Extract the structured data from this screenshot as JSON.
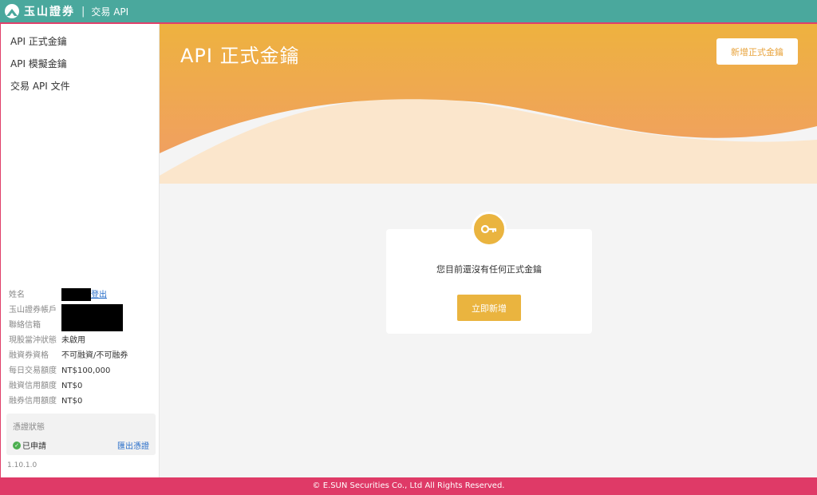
{
  "header": {
    "brand": "玉山證券",
    "separator": "|",
    "product": "交易 API"
  },
  "sidebar": {
    "nav": [
      {
        "label": "API 正式金鑰"
      },
      {
        "label": "API 模擬金鑰"
      },
      {
        "label": "交易 API 文件"
      }
    ],
    "info": {
      "name_label": "姓名",
      "logout": "登出",
      "account_label": "玉山證券帳戶",
      "email_label": "聯絡信箱",
      "daytrade_label": "現股當沖狀態",
      "daytrade_value": "未啟用",
      "margin_label": "融資券資格",
      "margin_value": "不可融資/不可融券",
      "daily_limit_label": "每日交易額度",
      "daily_limit_value": "NT$100,000",
      "margin_credit_label": "融資信用額度",
      "margin_credit_value": "NT$0",
      "short_credit_label": "融券信用額度",
      "short_credit_value": "NT$0"
    },
    "certificate": {
      "title": "憑證狀態",
      "status": "已申請",
      "export": "匯出憑證"
    },
    "version": "1.10.1.0"
  },
  "main": {
    "title": "API 正式金鑰",
    "add_button": "新增正式金鑰",
    "empty_message": "您目前還沒有任何正式金鑰",
    "create_button": "立即新增"
  },
  "footer": {
    "copyright": "© E.SUN Securities Co., Ltd All Rights Reserved."
  },
  "colors": {
    "header": "#4aa89d",
    "accent_orange": "#eab43f",
    "footer": "#df3a67",
    "link": "#2a6fc9"
  }
}
